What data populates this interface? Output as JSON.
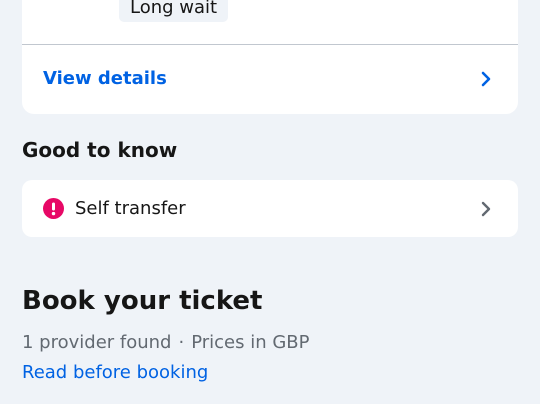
{
  "itinerary_card": {
    "badge": "Long wait",
    "view_details_label": "View details"
  },
  "good_to_know": {
    "title": "Good to know",
    "items": [
      {
        "label": "Self transfer",
        "icon": "alert-icon",
        "icon_color": "#e70866"
      }
    ]
  },
  "booking": {
    "title": "Book your ticket",
    "providers_text": "1 provider found",
    "separator": "·",
    "currency_text": "Prices in GBP",
    "read_link": "Read before booking"
  },
  "colors": {
    "background": "#eff3f8",
    "link": "#0062e3",
    "alert": "#e70866",
    "muted_text": "#626971"
  }
}
